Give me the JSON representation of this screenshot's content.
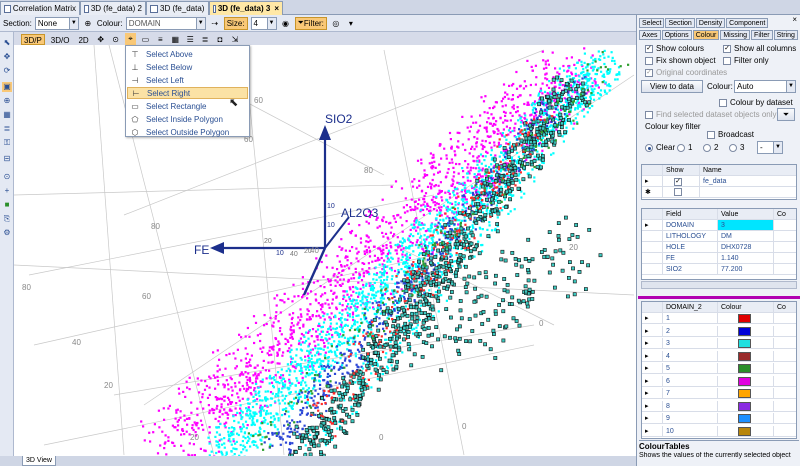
{
  "tabs": [
    {
      "label": "Correlation Matrix",
      "active": false
    },
    {
      "label": "3D (fe_data) 2",
      "active": false
    },
    {
      "label": "3D (fe_data)",
      "active": false
    },
    {
      "label": "3D (fe_data) 3",
      "active": true
    }
  ],
  "toolbar": {
    "section_label": "Section:",
    "section_value": "None",
    "colour_label": "Colour:",
    "colour_value": "DOMAIN",
    "size_label": "Size:",
    "size_value": "4",
    "filter_label": "Filter:"
  },
  "view_modes": [
    "3D/P",
    "3D/O",
    "2D"
  ],
  "select_menu": {
    "items": [
      {
        "label": "Select Above",
        "icon": "select-above-icon"
      },
      {
        "label": "Select Below",
        "icon": "select-below-icon"
      },
      {
        "label": "Select Left",
        "icon": "select-left-icon"
      },
      {
        "label": "Select Right",
        "icon": "select-right-icon"
      },
      {
        "label": "Select Rectangle",
        "icon": "select-rectangle-icon"
      },
      {
        "label": "Select Inside Polygon",
        "icon": "inside-polygon-icon"
      },
      {
        "label": "Select Outside Polygon",
        "icon": "outside-polygon-icon"
      }
    ],
    "highlighted_index": 3
  },
  "view3d": {
    "axis_labels": {
      "y": "SIO2",
      "z": "AL2O3",
      "x": "FE"
    },
    "axis_ticks": {
      "y": "10",
      "z": "10",
      "x1": "10",
      "x2": "20",
      "x3": "20",
      "x4": "40"
    },
    "grid_labels": [
      "80",
      "60",
      "40",
      "20",
      "80",
      "60",
      "40",
      "20",
      "0",
      "0",
      "0",
      "20",
      "80",
      "60"
    ],
    "colors": {
      "domain1": "#ff00ff",
      "domain2": "#00ffff",
      "domain3": "#111111",
      "domain4": "#2b45d6",
      "domain5": "#ff2a2a",
      "teal": "#3cc9c0"
    },
    "bottom_tab": "3D View"
  },
  "right_panel": {
    "tabs_row1": [
      "Select",
      "Section",
      "Density",
      "Component"
    ],
    "tabs_row2": [
      "Axes",
      "Options",
      "Colour",
      "Missing",
      "Filter",
      "String"
    ],
    "active_tab": "Colour",
    "checks": [
      {
        "label": "Show colours",
        "checked": true
      },
      {
        "label": "Show all columns",
        "checked": true
      },
      {
        "label": "Fix shown object",
        "checked": false
      },
      {
        "label": "Filter only",
        "checked": false
      },
      {
        "label": "Original coordinates",
        "checked": true,
        "disabled": true
      }
    ],
    "view_to_data": "View to data",
    "colour_label": "Colour:",
    "colour_value": "Auto",
    "colour_by_dataset": "Colour by dataset",
    "find_selected": "Find selected dataset objects only",
    "colour_key_filter": "Colour key filter",
    "broadcast": "Broadcast",
    "radios": [
      "Clear",
      "1",
      "2",
      "3"
    ],
    "radio_selected": "Clear",
    "radio_combo": "-",
    "datasets_grid": {
      "headers": [
        "Show",
        "Name"
      ],
      "rows": [
        {
          "show": true,
          "name": "fe_data"
        },
        {
          "show": false,
          "name": ""
        }
      ]
    },
    "field_grid": {
      "headers": [
        "Field",
        "Value",
        "Co"
      ],
      "rows": [
        {
          "field": "DOMAIN",
          "value": "3"
        },
        {
          "field": "LITHOLOGY",
          "value": "DM"
        },
        {
          "field": "HOLE",
          "value": "DHX0728"
        },
        {
          "field": "FE",
          "value": "1.140"
        },
        {
          "field": "SIO2",
          "value": "77.200"
        }
      ]
    },
    "colour_grid": {
      "headers": [
        "DOMAIN_2",
        "Colour",
        "Co"
      ],
      "rows": [
        {
          "key": "1",
          "color": "#e00000"
        },
        {
          "key": "2",
          "color": "#0000d8"
        },
        {
          "key": "3",
          "color": "#20e0e0"
        },
        {
          "key": "4",
          "color": "#9a2a2a"
        },
        {
          "key": "5",
          "color": "#2a8f2a"
        },
        {
          "key": "6",
          "color": "#e000e0"
        },
        {
          "key": "7",
          "color": "#ffa500"
        },
        {
          "key": "8",
          "color": "#8a2be2"
        },
        {
          "key": "9",
          "color": "#1e90ff"
        },
        {
          "key": "10",
          "color": "#b8860b"
        }
      ]
    },
    "footer_title": "ColourTables",
    "footer_desc": "Shows the values of the currently selected object"
  }
}
